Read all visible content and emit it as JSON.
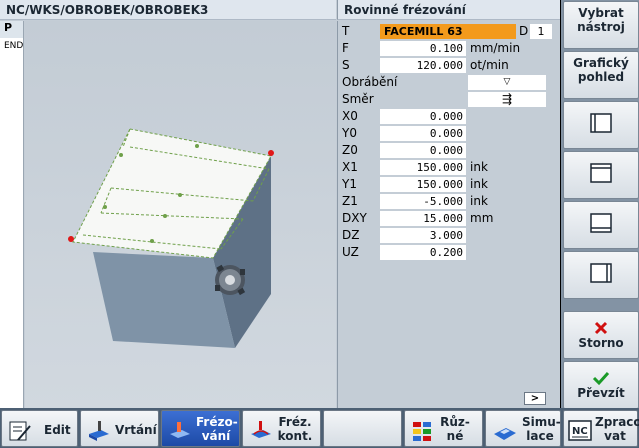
{
  "window": {
    "path_title": "NC/WKS/OBROBEK/OBROBEK3",
    "dialog_title": "Rovinné frézování"
  },
  "program_column": {
    "items": [
      "P",
      "END"
    ]
  },
  "params": {
    "T": {
      "label": "T",
      "value": "FACEMILL 63",
      "d_label": "D",
      "d_value": "1"
    },
    "F": {
      "label": "F",
      "value": "0.100",
      "unit": "mm/min"
    },
    "S": {
      "label": "S",
      "value": "120.000",
      "unit": "ot/min"
    },
    "machining": {
      "label": "Obrábění",
      "value": "▽"
    },
    "direction": {
      "label": "Směr",
      "value": "⇶"
    },
    "X0": {
      "label": "X0",
      "value": "0.000"
    },
    "Y0": {
      "label": "Y0",
      "value": "0.000"
    },
    "Z0": {
      "label": "Z0",
      "value": "0.000"
    },
    "X1": {
      "label": "X1",
      "value": "150.000",
      "unit": "ink"
    },
    "Y1": {
      "label": "Y1",
      "value": "150.000",
      "unit": "ink"
    },
    "Z1": {
      "label": "Z1",
      "value": "-5.000",
      "unit": "ink"
    },
    "DXY": {
      "label": "DXY",
      "value": "15.000",
      "unit": "mm"
    },
    "DZ": {
      "label": "DZ",
      "value": "3.000"
    },
    "UZ": {
      "label": "UZ",
      "value": "0.200"
    }
  },
  "scroll": {
    "label": ">"
  },
  "vertical_softkeys": {
    "select_tool": "Vybrat nástroj",
    "graphic_view": "Grafický pohled",
    "cancel": "Storno",
    "accept": "Převzít"
  },
  "horizontal_softkeys": {
    "edit": "Edit",
    "turning": "Vrtání",
    "milling": "Frézo-vání",
    "contour_milling": "Fréz. kont.",
    "misc": "Růz-né",
    "simulation": "Simu-lace",
    "process": "Zpraco vat"
  },
  "colors": {
    "accent_blue": "#1d4aa6",
    "tool_orange": "#f39a1c",
    "cancel_red": "#d01010",
    "accept_green": "#1a9a28"
  }
}
